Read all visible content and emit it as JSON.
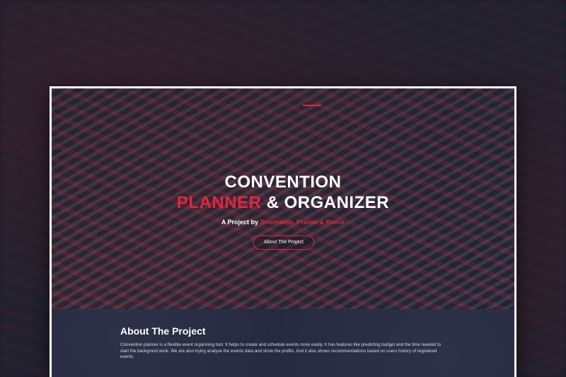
{
  "hero": {
    "title_line1": "CONVENTION",
    "title_highlight": "PLANNER",
    "title_rest": " & ORGANIZER",
    "byline_prefix": "A Project by ",
    "byline_names": "Sreemanth, Pranav & Reece",
    "button_label": "About The Project"
  },
  "about": {
    "heading": "About The Project",
    "body": "Convention planner is a flexible event organising tool. It helps to create and schedule events more easily. It has features like predicting budget and the time needed to start the backgrond work. We are also trying analyse the events data and show the profits. And it also shows recommendations based on users history of registered events."
  },
  "colors": {
    "accent": "#e5243f",
    "background": "#262a40"
  }
}
